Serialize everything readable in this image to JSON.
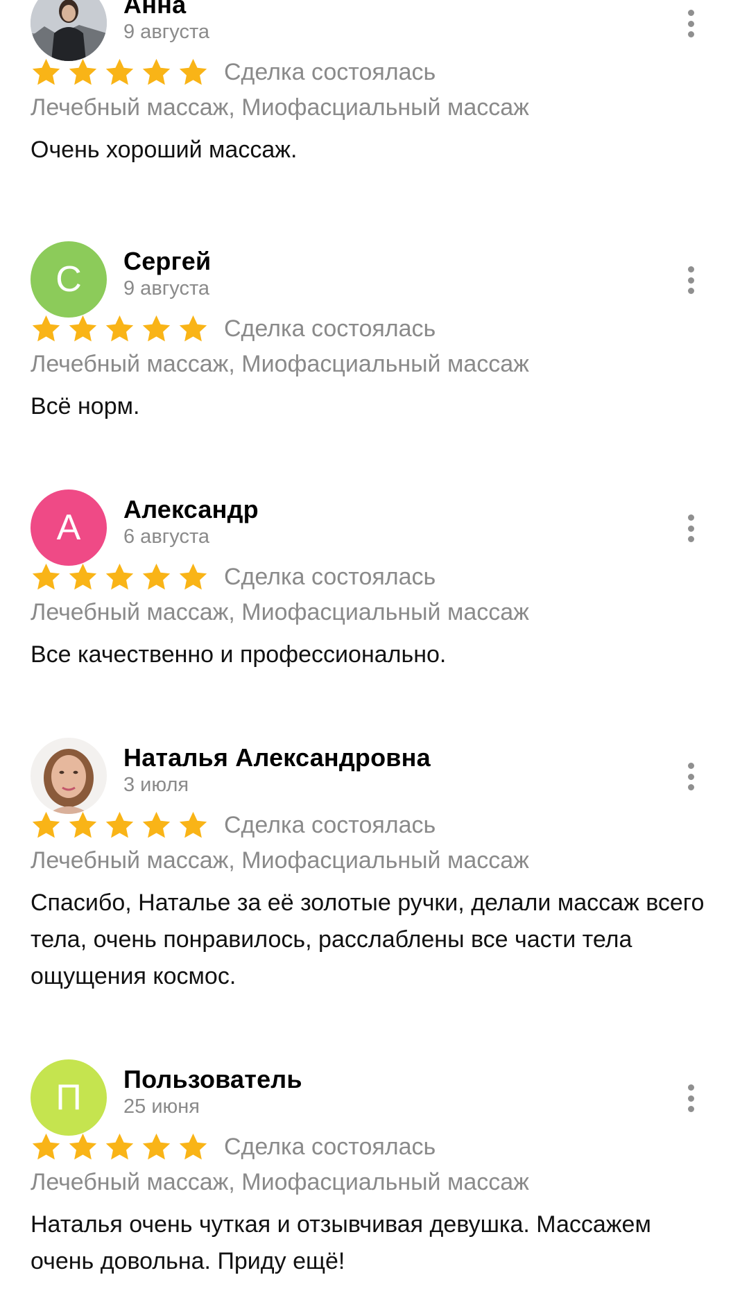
{
  "colors": {
    "star": "#F9B417",
    "muted_text": "#8A8A8A",
    "avatar_sergey": "#8CCB5A",
    "avatar_alexandr": "#EF4A86",
    "avatar_user": "#C5E44F"
  },
  "reviews": [
    {
      "name": "Анна",
      "date": "9 августа",
      "avatar_type": "photo",
      "avatar_letter": "",
      "stars": 5,
      "deal": "Сделка состоялась",
      "services": "Лечебный массаж, Миофасциальный массаж",
      "text": "Очень хороший массаж."
    },
    {
      "name": "Сергей",
      "date": "9 августа",
      "avatar_type": "letter",
      "avatar_letter": "С",
      "stars": 5,
      "deal": "Сделка состоялась",
      "services": "Лечебный массаж, Миофасциальный массаж",
      "text": "Всё норм."
    },
    {
      "name": "Александр",
      "date": "6 августа",
      "avatar_type": "letter",
      "avatar_letter": "А",
      "stars": 5,
      "deal": "Сделка состоялась",
      "services": "Лечебный массаж, Миофасциальный массаж",
      "text": "Все качественно и профессионально."
    },
    {
      "name": "Наталья Александровна",
      "date": "3 июля",
      "avatar_type": "photo",
      "avatar_letter": "",
      "stars": 5,
      "deal": "Сделка состоялась",
      "services": "Лечебный массаж, Миофасциальный массаж",
      "text": "Спасибо, Наталье за её золотые ручки, делали массаж всего тела,  очень понравилось, расслаблены все части тела ощущения космос."
    },
    {
      "name": "Пользователь",
      "date": "25 июня",
      "avatar_type": "letter",
      "avatar_letter": "П",
      "stars": 5,
      "deal": "Сделка состоялась",
      "services": "Лечебный массаж, Миофасциальный массаж",
      "text": "Наталья очень чуткая и отзывчивая девушка. Массажем очень довольна. Приду ещё!"
    }
  ]
}
